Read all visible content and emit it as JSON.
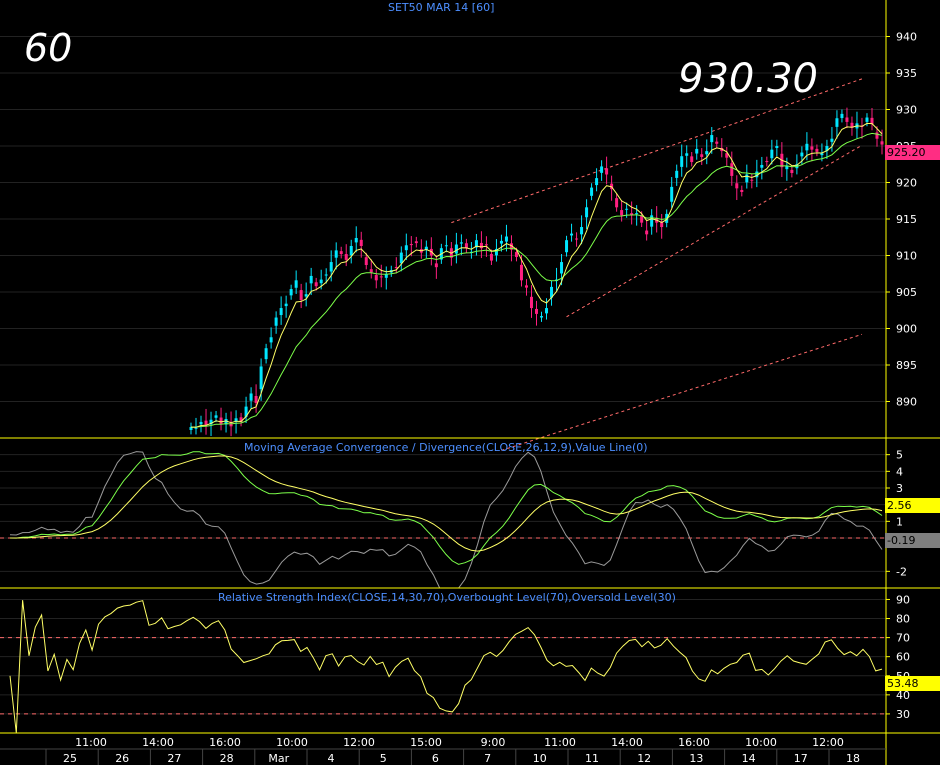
{
  "header": {
    "title": "SET50 MAR 14   [60]"
  },
  "annotations": {
    "timeframe": "60",
    "high_label": "930.30"
  },
  "price_tag": "925.20",
  "macd_tags": {
    "macd": "2.56",
    "hist": "-0.19"
  },
  "rsi_tag": "53.48",
  "colors": {
    "up": "#00e6ff",
    "down": "#ff1f80",
    "ma_fast": "#ffff66",
    "ma_slow": "#7cff4a",
    "axis": "#ffff00",
    "title": "#4d8fff",
    "dashed": "#ff6a6a",
    "hist": "#9a9a9a"
  },
  "chart_data": [
    {
      "type": "candlestick",
      "title": "SET50 MAR 14   [60]",
      "ylim": [
        885,
        945
      ],
      "yticks": [
        890,
        895,
        900,
        905,
        910,
        915,
        920,
        925,
        930,
        935,
        940
      ],
      "closes": [
        886.5,
        886.4,
        887.2,
        886.8,
        887.5,
        888.1,
        886.9,
        887.6,
        886.6,
        887.7,
        887.2,
        889.3,
        891.1,
        889.8,
        894.8,
        897.3,
        898.8,
        901.5,
        902.8,
        903.4,
        905.4,
        906.6,
        903.9,
        904.7,
        907.2,
        905.8,
        906.7,
        907.4,
        909.1,
        910.7,
        910.2,
        909.4,
        911.3,
        912.4,
        911.3,
        908.7,
        907.7,
        906.6,
        907.0,
        907.4,
        908.0,
        908.4,
        910.4,
        911.4,
        911.5,
        911.7,
        910.4,
        911.2,
        910.0,
        908.4,
        911.0,
        911.4,
        909.7,
        911.5,
        911.8,
        911.0,
        910.5,
        912.1,
        911.0,
        911.4,
        909.3,
        910.9,
        912.0,
        912.6,
        910.8,
        909.8,
        906.6,
        905.6,
        902.8,
        902.0,
        901.7,
        902.8,
        905.7,
        906.7,
        909.1,
        912.1,
        913.0,
        912.3,
        913.9,
        916.6,
        919.3,
        920.6,
        922.2,
        921.1,
        919.1,
        916.6,
        915.5,
        916.4,
        915.6,
        915.8,
        914.5,
        912.9,
        915.5,
        914.5,
        913.9,
        915.7,
        919.4,
        921.6,
        923.6,
        924.0,
        922.8,
        924.6,
        923.5,
        924.3,
        926.5,
        925.3,
        924.3,
        923.4,
        920.9,
        919.2,
        918.7,
        921.1,
        920.3,
        921.5,
        922.4,
        922.8,
        924.5,
        925.0,
        922.1,
        922.3,
        921.3,
        922.5,
        924.1,
        925.3,
        924.5,
        924.2,
        924.0,
        925.0,
        926.0,
        928.8,
        929.4,
        928.3,
        927.5,
        928.1,
        927.6,
        928.9,
        928.0,
        926.0,
        925.2
      ],
      "ma_fast": "EMA-5 of closes",
      "ma_slow": "EMA-15 of closes",
      "trendlines": [
        {
          "x": [
            52,
            134
          ],
          "y": [
            914.5,
            934.2
          ]
        },
        {
          "x": [
            75,
            134
          ],
          "y": [
            901.6,
            925.1
          ]
        },
        {
          "x": [
            62,
            134
          ],
          "y": [
            883.3,
            899.2
          ]
        }
      ],
      "last_value": 925.2
    },
    {
      "type": "line",
      "title": "Moving Average Convergence / Divergence(CLOSE,26,12,9),Value Line(0)",
      "ylim": [
        -3,
        6
      ],
      "yticks": [
        -2,
        0,
        1,
        2,
        3,
        4,
        5
      ],
      "series_values": {
        "macd": 2.56,
        "signal": 2.75,
        "hist": -0.19
      }
    },
    {
      "type": "line",
      "title": "Relative Strength Index(CLOSE,14,30,70),Overbought Level(70),Oversold Level(30)",
      "ylim": [
        20,
        96
      ],
      "yticks": [
        30,
        40,
        50,
        60,
        70,
        80,
        90
      ],
      "levels": [
        70,
        30
      ],
      "last_value": 53.48
    }
  ],
  "xaxis": {
    "top": [
      "11:00",
      "14:00",
      "16:00",
      "10:00",
      "12:00",
      "15:00",
      "9:00",
      "11:00",
      "14:00",
      "16:00",
      "10:00",
      "12:00"
    ],
    "bottom": [
      "25",
      "26",
      "27",
      "28",
      "Mar",
      "4",
      "5",
      "6",
      "7",
      "10",
      "11",
      "12",
      "13",
      "14",
      "17",
      "18"
    ]
  }
}
